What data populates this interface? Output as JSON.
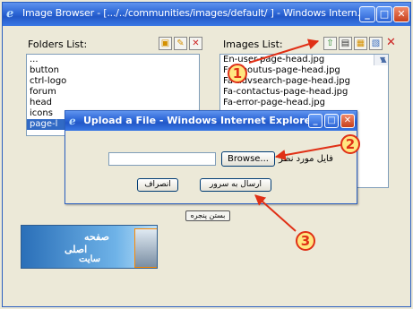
{
  "window": {
    "title": "Image Browser - [.../../communities/images/default/ ] - Windows Intern...",
    "controls": [
      "minimize",
      "maximize",
      "close"
    ]
  },
  "folders": {
    "label": "Folders List:",
    "items": [
      "...",
      "button",
      "ctrl-logo",
      "forum",
      "head",
      "icons",
      "page-l"
    ],
    "selected_index": 6
  },
  "images": {
    "label": "Images List:",
    "items": [
      "En-user-page-head.jpg",
      "Fa-aboutus-page-head.jpg",
      "Fa-advsearch-page-head.jpg",
      "Fa-contactus-page-head.jpg",
      "Fa-error-page-head.jpg"
    ]
  },
  "icons": {
    "folders_toolbar": [
      "new-folder-icon",
      "edit-folder-icon",
      "delete-folder-icon"
    ],
    "images_toolbar": [
      "upload-icon",
      "view-icon",
      "edit-icon",
      "properties-icon",
      "delete-icon"
    ]
  },
  "bottom_button": "بستن پنجره",
  "logo": {
    "line1": "صفحه",
    "line2": "اصلی",
    "line3": "سایت"
  },
  "upload_dialog": {
    "title": "Upload a File - Windows Internet Explorer",
    "file_value": "",
    "browse_label": "Browse...",
    "file_label": "فایل مورد نظر",
    "submit_label": "ارسال به سرور",
    "cancel_label": "انصراف"
  },
  "annotations": [
    "1",
    "2",
    "3"
  ],
  "colors": {
    "titlebar": "#2c66d6",
    "selection": "#316ac5",
    "annotation": "#e03016"
  }
}
